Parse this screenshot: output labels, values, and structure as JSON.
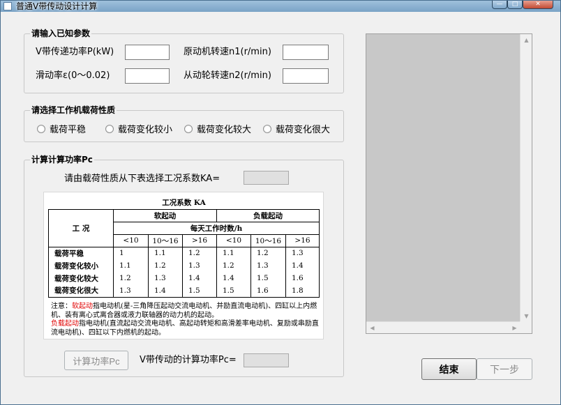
{
  "window": {
    "title": "普通V带传动设计计算"
  },
  "known": {
    "title": "请输入已知参数",
    "power_label": "V带传递功率P(kW)",
    "n1_label": "原动机转速n1(r/min)",
    "slip_label": "滑动率ε(0～0.02)",
    "n2_label": "从动轮转速n2(r/min)",
    "power_value": "",
    "n1_value": "",
    "slip_value": "",
    "n2_value": ""
  },
  "load": {
    "title": "请选择工作机载荷性质",
    "options": [
      "载荷平稳",
      "载荷变化较小",
      "载荷变化较大",
      "载荷变化很大"
    ]
  },
  "calc": {
    "title": "计算计算功率Pc",
    "ka_prompt": "请由载荷性质从下表选择工况系数KA=",
    "ka_value": "",
    "pc_label": "V带传动的计算功率Pc=",
    "pc_value": "",
    "calc_button": "计算功率Pc"
  },
  "ka_table": {
    "caption": "工况系数 KA",
    "col_condition": "工 况",
    "soft_start": "软起动",
    "load_start": "负载起动",
    "hours_header": "每天工作时数/h",
    "hours": [
      "<10",
      "10～16",
      ">16",
      "<10",
      "10～16",
      ">16"
    ],
    "rows": [
      {
        "name": "载荷平稳",
        "values": [
          "1",
          "1.1",
          "1.2",
          "1.1",
          "1.2",
          "1.3"
        ]
      },
      {
        "name": "载荷变化较小",
        "values": [
          "1.1",
          "1.2",
          "1.3",
          "1.2",
          "1.3",
          "1.4"
        ]
      },
      {
        "name": "载荷变化较大",
        "values": [
          "1.2",
          "1.3",
          "1.4",
          "1.4",
          "1.5",
          "1.6"
        ]
      },
      {
        "name": "载荷变化很大",
        "values": [
          "1.3",
          "1.4",
          "1.5",
          "1.5",
          "1.6",
          "1.8"
        ]
      }
    ],
    "note_prefix": "注意：",
    "note_soft": "软起动",
    "note_soft_text": "指电动机(星-三角降压起动交流电动机、并励直流电动机)、四缸以上内燃机、装有离心式离合器或液力联轴器的动力机的起动。",
    "note_load": "负载起动",
    "note_load_text": "指电动机(直流起动交流电动机、高起动转矩和高滑差率电动机、复励或串励直流电动机)、四缸以下内燃机的起动。"
  },
  "buttons": {
    "finish": "结束",
    "next": "下一步"
  },
  "colors": {
    "note_highlight": "#e00000",
    "listbox_bg": "#c8c8c8"
  }
}
